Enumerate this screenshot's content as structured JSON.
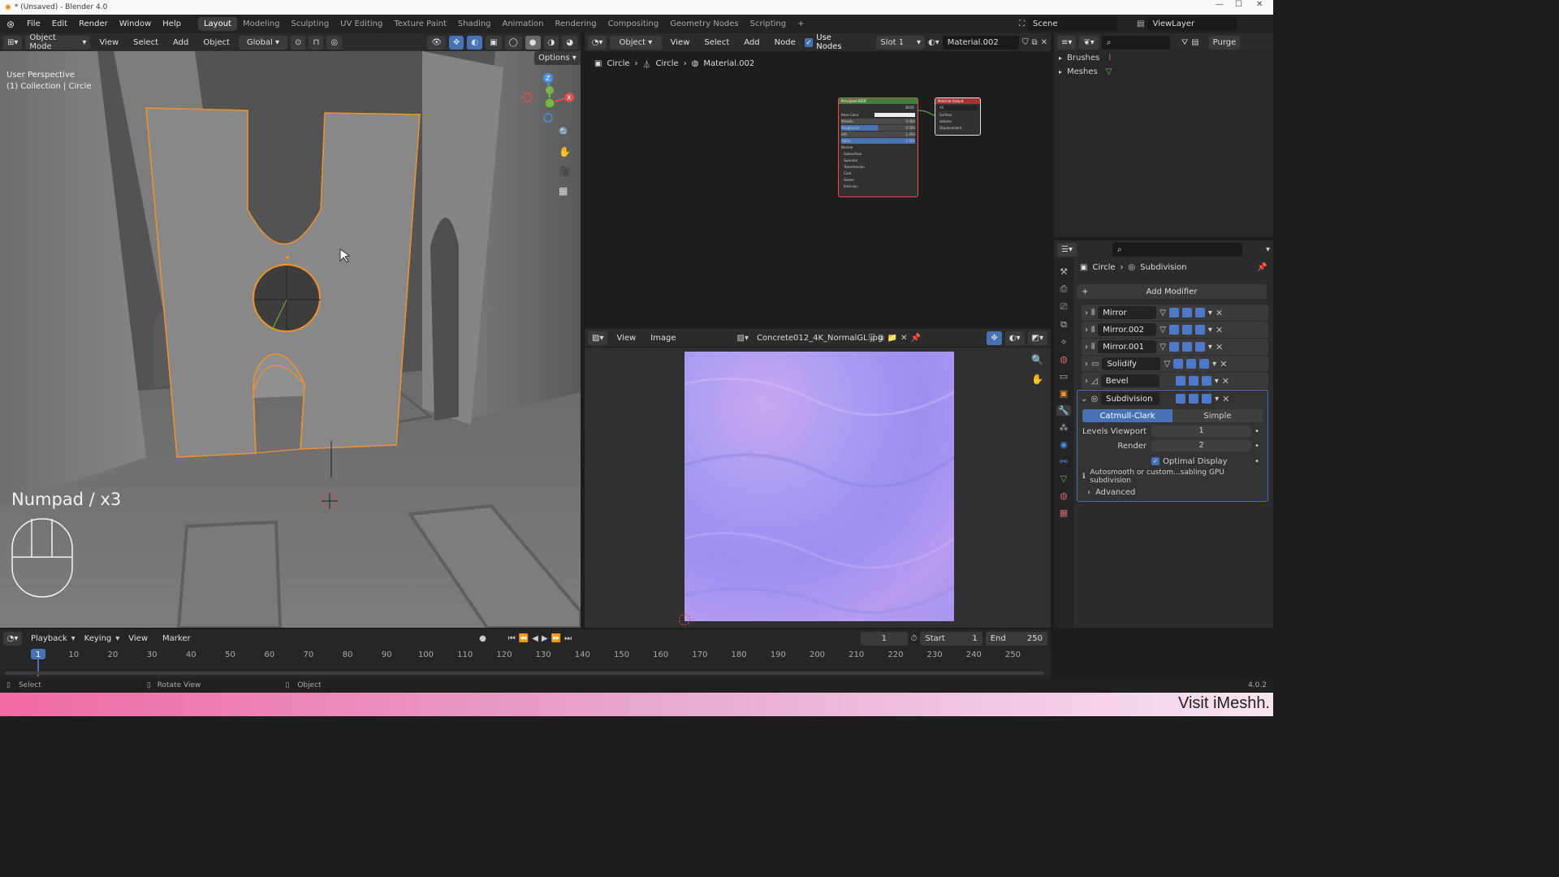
{
  "window": {
    "title": "* (Unsaved) - Blender 4.0"
  },
  "menu": [
    "File",
    "Edit",
    "Render",
    "Window",
    "Help"
  ],
  "workspaces": [
    "Layout",
    "Modeling",
    "Sculpting",
    "UV Editing",
    "Texture Paint",
    "Shading",
    "Animation",
    "Rendering",
    "Compositing",
    "Geometry Nodes",
    "Scripting"
  ],
  "workspace_add": "+",
  "scene": {
    "name": "Scene",
    "viewlayer": "ViewLayer"
  },
  "viewport": {
    "mode": "Object Mode",
    "menus": [
      "View",
      "Select",
      "Add",
      "Object"
    ],
    "orientation": "Global",
    "options": "Options",
    "perspective_label": "User Perspective",
    "collection_label": "(1) Collection | Circle",
    "keystroke_label": "Numpad / x3"
  },
  "node_editor": {
    "object_mode": "Object",
    "menus": [
      "View",
      "Select",
      "Add",
      "Node"
    ],
    "use_nodes_label": "Use Nodes",
    "slot": "Slot 1",
    "material": "Material.002",
    "breadcrumb": [
      "Circle",
      "Circle",
      "Material.002"
    ],
    "bsdf_node": {
      "title": "Principled BSDF",
      "output": "BSDF",
      "rows": [
        "Base Color",
        "Metallic",
        "Roughness",
        "IOR",
        "Alpha",
        "Normal",
        "Subsurface",
        "Specular",
        "Transmission",
        "Coat",
        "Sheen",
        "Emission"
      ],
      "values": [
        "",
        "0.000",
        "0.500",
        "1.450",
        "1.000"
      ]
    },
    "output_node": {
      "title": "Material Output",
      "target": "All",
      "rows": [
        "Surface",
        "Volume",
        "Displacement"
      ]
    }
  },
  "image_editor": {
    "menus": [
      "View",
      "Image"
    ],
    "image_name": "Concrete012_4K_NormalGL.jpg"
  },
  "outliner": {
    "items": [
      "Brushes",
      "Meshes"
    ]
  },
  "properties": {
    "breadcrumb": [
      "Circle",
      "Subdivision"
    ],
    "add_modifier": "Add Modifier",
    "modifiers": [
      "Mirror",
      "Mirror.002",
      "Mirror.001",
      "Solidify",
      "Bevel",
      "Subdivision"
    ],
    "subdivision": {
      "type_options": [
        "Catmull-Clark",
        "Simple"
      ],
      "levels_viewport_label": "Levels Viewport",
      "levels_viewport": "1",
      "render_label": "Render",
      "render": "2",
      "optimal_display": "Optimal Display",
      "info": "Autosmooth or custom...sabling GPU subdivision",
      "advanced": "Advanced"
    }
  },
  "timeline": {
    "menus": [
      "Playback",
      "Keying",
      "View",
      "Marker"
    ],
    "current_frame": "1",
    "start_label": "Start",
    "start": "1",
    "end_label": "End",
    "end": "250",
    "ticks": [
      "1",
      "10",
      "20",
      "30",
      "40",
      "50",
      "60",
      "70",
      "80",
      "90",
      "100",
      "110",
      "120",
      "130",
      "140",
      "150",
      "160",
      "170",
      "180",
      "190",
      "200",
      "210",
      "220",
      "230",
      "240",
      "250"
    ]
  },
  "statusbar": {
    "items": [
      "Select",
      "Rotate View",
      "Object"
    ],
    "version": "4.0.2"
  },
  "banner": {
    "text": "Visit iMeshh."
  },
  "colors": {
    "accent": "#4772b3",
    "selection": "#f0932b",
    "node_green": "#3f7f3a",
    "node_red": "#a8322f"
  }
}
